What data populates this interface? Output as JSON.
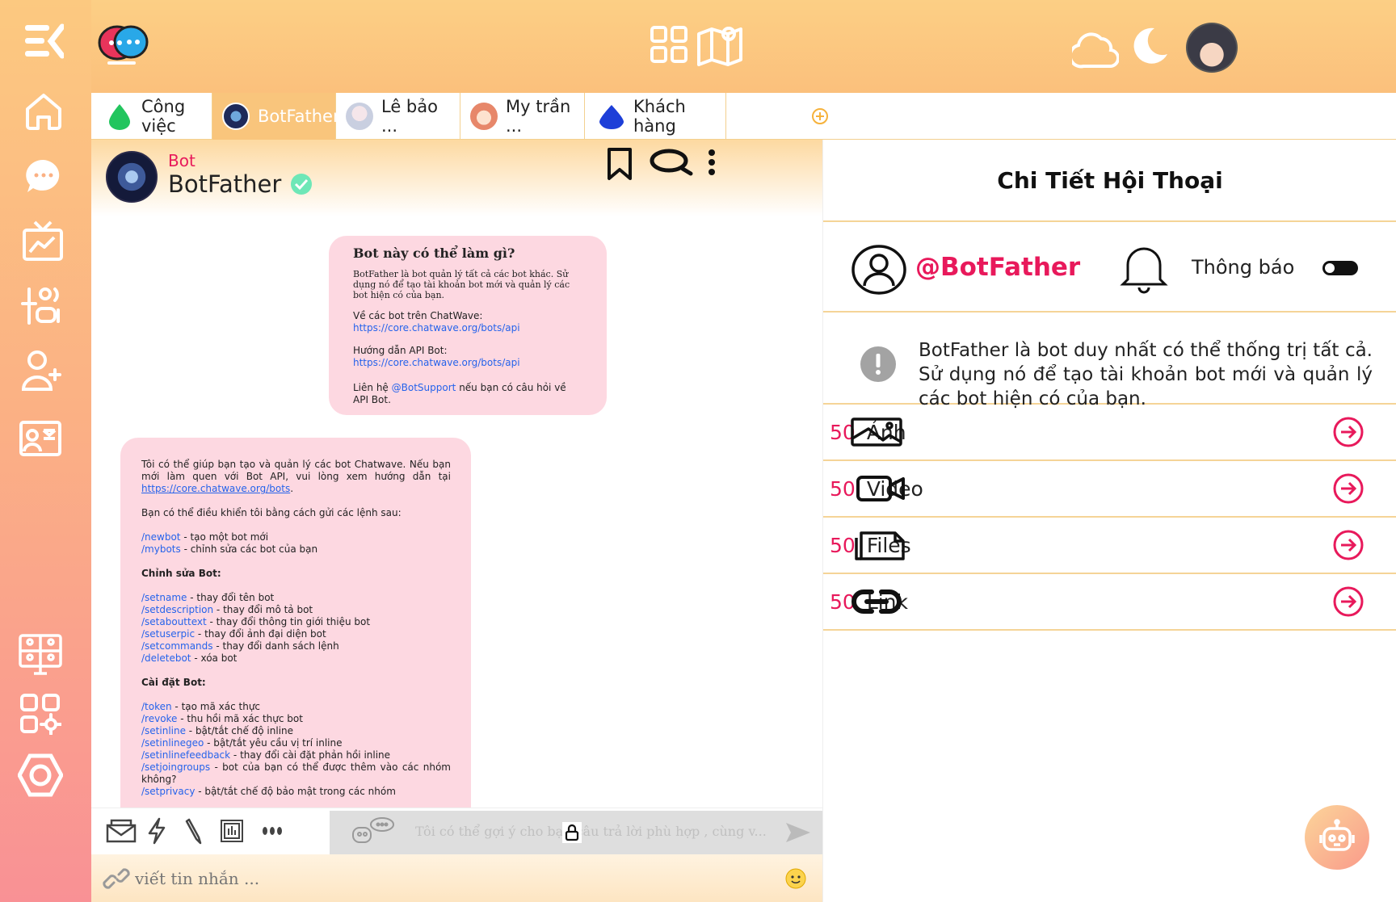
{
  "app": {
    "colors": {
      "accent": "#e8195b",
      "orange": "#fbc07c",
      "pink": "#f99195",
      "bubble": "#fdd8e1",
      "link": "#2563eb"
    }
  },
  "tabs": [
    {
      "label": "Công việc",
      "icon": "green-drop-icon",
      "active": false
    },
    {
      "label": "BotFather",
      "icon": "botfather-avatar",
      "active": true
    },
    {
      "label": "Lê bảo ...",
      "icon": "user-avatar",
      "active": false
    },
    {
      "label": "My trần ...",
      "icon": "user-avatar",
      "active": false
    },
    {
      "label": "Khách hàng",
      "icon": "blue-drop-icon",
      "active": false
    }
  ],
  "chat": {
    "tag": "Bot",
    "name": "BotFather",
    "intro": {
      "title": "Bot này có thể làm gì?",
      "desc": "BotFather là bot quản lý tất cả các bot khác. Sử dụng nó để tạo tài khoản bot mới và quản lý các bot hiện có của bạn.",
      "about_label": "Về các bot trên ChatWave:",
      "about_link": "https://core.chatwave.org/bots/api",
      "guide_label": "Hướng dẫn API Bot:",
      "guide_link": "https://core.chatwave.org/bots/api",
      "contact_pre": "Liên hệ",
      "contact_handle": "@BotSupport",
      "contact_post": "nếu bạn có câu hỏi về API Bot."
    },
    "help": {
      "p1": "Tôi có thể giúp bạn tạo và quản lý các bot Chatwave. Nếu bạn mới làm quen với Bot API, vui lòng xem hướng dẫn tại",
      "p1_link": "https://core.chatwave.org/bots",
      "p2": "Bạn có thể điều khiển tôi bằng cách gửi các lệnh sau:",
      "group1": [
        {
          "cmd": "/newbot",
          "desc": " - tạo một bot mới"
        },
        {
          "cmd": "/mybots",
          "desc": " - chỉnh sửa các bot của bạn"
        }
      ],
      "h2": "Chỉnh sửa Bot:",
      "group2": [
        {
          "cmd": "/setname",
          "desc": " - thay đổi tên bot"
        },
        {
          "cmd": "/setdescription",
          "desc": " - thay đổi mô tả bot"
        },
        {
          "cmd": "/setabouttext",
          "desc": " - thay đổi thông tin giới thiệu bot"
        },
        {
          "cmd": "/setuserpic",
          "desc": " - thay đổi ảnh đại diện bot"
        },
        {
          "cmd": "/setcommands",
          "desc": " - thay đổi danh sách lệnh"
        },
        {
          "cmd": "/deletebot",
          "desc": " - xóa bot"
        }
      ],
      "h3": "Cài đặt Bot:",
      "group3": [
        {
          "cmd": "/token",
          "desc": " - tạo mã xác thực"
        },
        {
          "cmd": "/revoke",
          "desc": " - thu hồi mã xác thực bot"
        },
        {
          "cmd": "/setinline",
          "desc": " - bật/tắt chế độ inline"
        },
        {
          "cmd": "/setinlinegeo",
          "desc": " - bật/tắt yêu cầu vị trí inline"
        },
        {
          "cmd": "/setinlinefeedback",
          "desc": " - thay đổi cài đặt phản hồi inline"
        },
        {
          "cmd": "/setjoingroups",
          "desc": " - bot của bạn có thể được thêm vào các nhóm không?"
        },
        {
          "cmd": "/setprivacy",
          "desc": " - bật/tắt chế độ bảo mật trong các nhóm"
        }
      ]
    },
    "suggest_text": "Tôi có thể gợi ý cho bạn câu trả lời phù hợp , cùng v...",
    "input_placeholder": "viết tin nhắn ..."
  },
  "details": {
    "title": "Chi Tiết Hội Thoại",
    "handle": "@BotFather",
    "notif_label": "Thông báo",
    "notif_on": false,
    "description": "BotFather là bot duy nhất có thể thống trị tất cả. Sử dụng nó để tạo tài khoản bot mới và quản lý các bot hiện có của bạn.",
    "media": [
      {
        "count": "50",
        "label": "Ảnh",
        "icon": "image-icon"
      },
      {
        "count": "50",
        "label": "Video",
        "icon": "video-icon"
      },
      {
        "count": "50",
        "label": "Files",
        "icon": "files-icon"
      },
      {
        "count": "50",
        "label": "Link",
        "icon": "link-icon"
      }
    ]
  }
}
